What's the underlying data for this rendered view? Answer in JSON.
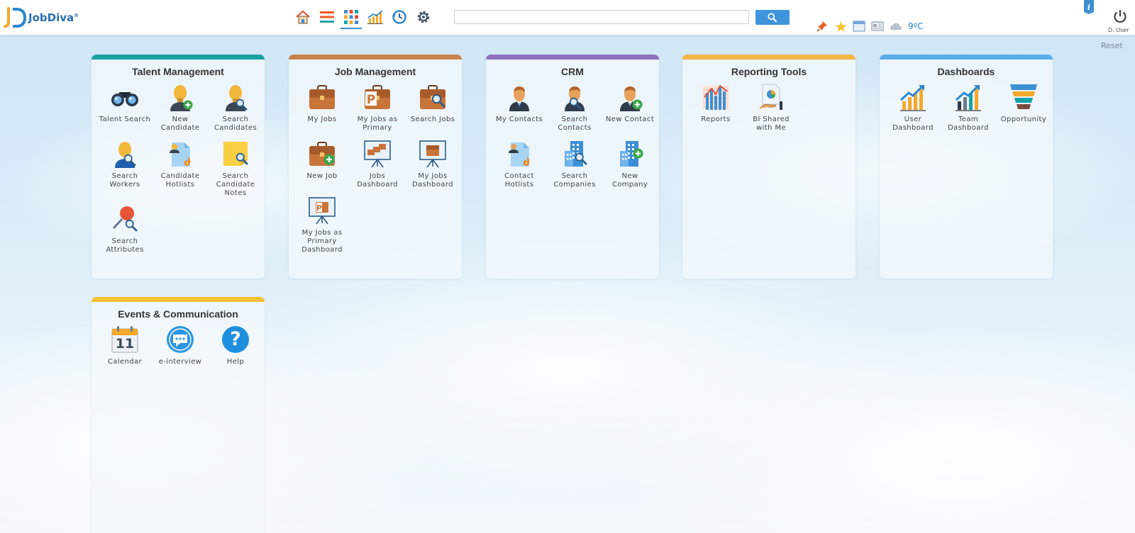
{
  "header": {
    "logo_text": "JobDiva",
    "logo_mark": "®",
    "search": {
      "value": "",
      "placeholder": ""
    },
    "nav_icons": [
      "home-icon",
      "list-icon",
      "grid-icon",
      "chart-icon",
      "clock-icon",
      "gear-icon"
    ],
    "status_icons": [
      "pin-icon",
      "star-icon",
      "calendar-window-icon",
      "news-icon",
      "cloud-icon"
    ],
    "weather": "9ºC",
    "user_label": "D. User",
    "reset_label": "Reset"
  },
  "colors": {
    "talent": "#17a2a4",
    "job": "#c8844a",
    "crm": "#8c6fbe",
    "reporting": "#f4b445",
    "dashboards": "#5aaee8",
    "events": "#f4c232",
    "accent": "#3f95dc"
  },
  "panels": {
    "talent": {
      "title": "Talent Management",
      "tiles": [
        {
          "label": "Talent Search",
          "icon": "binoculars-icon"
        },
        {
          "label": "New Candidate",
          "icon": "new-candidate-icon"
        },
        {
          "label": "Search Candidates",
          "icon": "search-candidates-icon"
        },
        {
          "label": "Search Workers",
          "icon": "search-workers-icon"
        },
        {
          "label": "Candidate Hotlists",
          "icon": "candidate-hotlists-icon"
        },
        {
          "label": "Search Candidate Notes",
          "icon": "search-notes-icon"
        },
        {
          "label": "Search Attributes",
          "icon": "search-attributes-icon"
        }
      ]
    },
    "job": {
      "title": "Job Management",
      "tiles": [
        {
          "label": "My Jobs",
          "icon": "briefcase-icon"
        },
        {
          "label": "My Jobs as Primary",
          "icon": "briefcase-primary-icon"
        },
        {
          "label": "Search Jobs",
          "icon": "search-jobs-icon"
        },
        {
          "label": "New Job",
          "icon": "new-job-icon"
        },
        {
          "label": "Jobs Dashboard",
          "icon": "jobs-dashboard-icon"
        },
        {
          "label": "My Jobs Dashboard",
          "icon": "my-jobs-dashboard-icon"
        },
        {
          "label": "My Jobs as Primary Dashboard",
          "icon": "primary-dashboard-icon"
        }
      ]
    },
    "crm": {
      "title": "CRM",
      "tiles": [
        {
          "label": "My Contacts",
          "icon": "contact-icon"
        },
        {
          "label": "Search Contacts",
          "icon": "search-contacts-icon"
        },
        {
          "label": "New Contact",
          "icon": "new-contact-icon"
        },
        {
          "label": "Contact Hotlists",
          "icon": "contact-hotlists-icon"
        },
        {
          "label": "Search Companies",
          "icon": "search-companies-icon"
        },
        {
          "label": "New Company",
          "icon": "new-company-icon"
        }
      ]
    },
    "reporting": {
      "title": "Reporting Tools",
      "tiles": [
        {
          "label": "Reports",
          "icon": "reports-icon"
        },
        {
          "label": "BI Shared with Me",
          "icon": "bi-shared-icon"
        }
      ]
    },
    "dashboards": {
      "title": "Dashboards",
      "tiles": [
        {
          "label": "User Dashboard",
          "icon": "user-dashboard-icon"
        },
        {
          "label": "Team Dashboard",
          "icon": "team-dashboard-icon"
        },
        {
          "label": "Opportunity",
          "icon": "funnel-icon"
        }
      ]
    },
    "events": {
      "title": "Events & Communication",
      "tiles": [
        {
          "label": "Calendar",
          "icon": "calendar-icon",
          "day": "11"
        },
        {
          "label": "e-interview",
          "icon": "chat-icon"
        },
        {
          "label": "Help",
          "icon": "help-icon",
          "glyph": "?"
        }
      ]
    }
  }
}
